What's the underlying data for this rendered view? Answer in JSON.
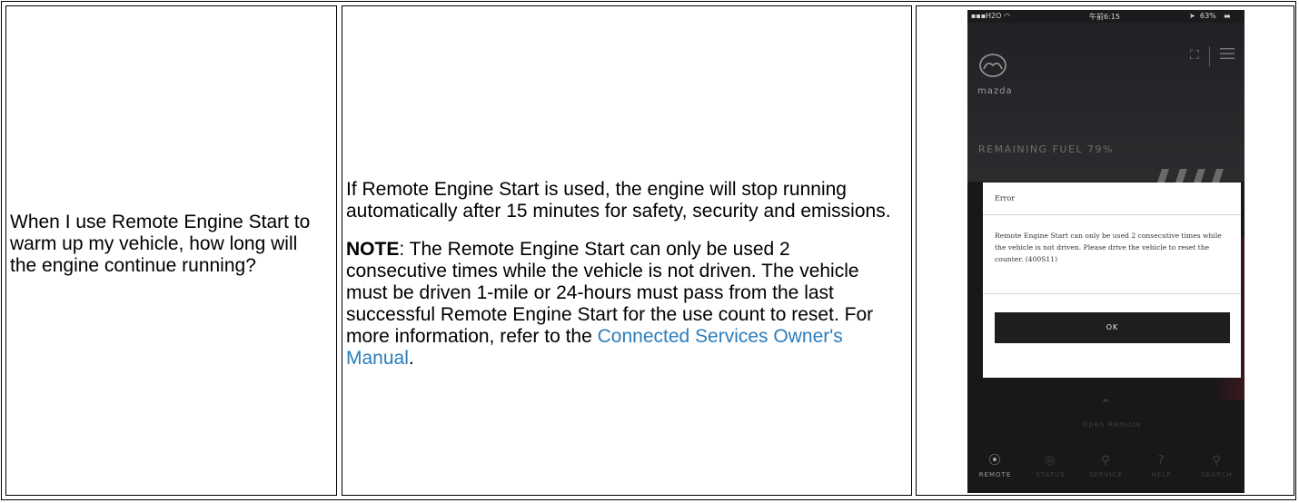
{
  "faq": {
    "question": "When I use Remote Engine Start to warm up my vehicle, how long will the engine continue running?",
    "answer_paragraph": "If Remote Engine Start is used, the engine will stop running automatically after 15 minutes for safety, security and emissions.",
    "note_label": "NOTE",
    "note_text": ": The Remote Engine Start can only be used 2 consecutive times while the vehicle is not driven. The vehicle must be driven 1-mile or 24-hours must pass from the last successful Remote Engine Start for the use count to reset. For more information, refer to the ",
    "link_text": "Connected Services Owner's Manual",
    "link_after": ".",
    "link_color": "#2a7dbd"
  },
  "phone": {
    "status_bar": {
      "carrier": "H2O",
      "time": "午前6:15",
      "battery": "63%"
    },
    "brand": "mazda",
    "remaining_fuel": "REMAINING FUEL 79%",
    "icons": [
      "mazda-logo-icon",
      "map-icon",
      "menu-icon",
      "remote-icon",
      "status-icon",
      "service-icon",
      "help-icon",
      "search-icon"
    ],
    "dialog": {
      "title": "Error",
      "message": "Remote Engine Start can only be used 2 consecutive times while the vehicle is not driven. Please drive the vehicle to reset the counter. (400S11)",
      "ok_label": "OK"
    },
    "open_remote": "Open Remote",
    "tabs": [
      {
        "label": "REMOTE",
        "icon": "remote-icon",
        "active": true
      },
      {
        "label": "STATUS",
        "icon": "status-icon",
        "active": false
      },
      {
        "label": "SERVICE",
        "icon": "service-icon",
        "active": false
      },
      {
        "label": "HELP",
        "icon": "help-icon",
        "active": false
      },
      {
        "label": "SEARCH",
        "icon": "search-icon",
        "active": false
      }
    ]
  }
}
